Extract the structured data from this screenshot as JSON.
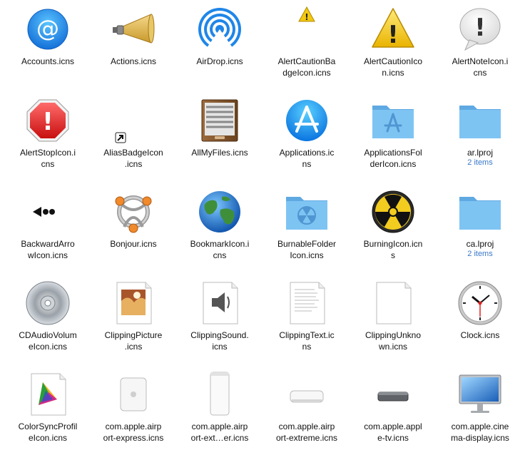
{
  "window": {
    "title": ""
  },
  "colors": {
    "label": "#111111",
    "sublabel": "#3a78c8",
    "folder": "#6cb8f0",
    "alert_yellow": "#f2c811",
    "alert_red": "#e02020"
  },
  "items": [
    {
      "label": "Accounts.icns",
      "icon": "at-sign-icon"
    },
    {
      "label": "Actions.icns",
      "icon": "megaphone-icon"
    },
    {
      "label": "AirDrop.icns",
      "icon": "airdrop-icon"
    },
    {
      "label": "AlertCautionBa\ndgeIcon.icns",
      "icon": "caution-badge-icon"
    },
    {
      "label": "AlertCautionIco\nn.icns",
      "icon": "caution-icon"
    },
    {
      "label": "AlertNoteIcon.i\ncns",
      "icon": "note-bubble-icon"
    },
    {
      "label": "AlertStopIcon.i\ncns",
      "icon": "stop-sign-icon"
    },
    {
      "label": "AliasBadgeIcon\n.icns",
      "icon": "alias-arrow-icon"
    },
    {
      "label": "AllMyFiles.icns",
      "icon": "file-drawer-icon"
    },
    {
      "label": "Applications.ic\nns",
      "icon": "app-store-icon"
    },
    {
      "label": "ApplicationsFol\nderIcon.icns",
      "icon": "applications-folder-icon"
    },
    {
      "label": "ar.lproj",
      "icon": "folder-icon",
      "sub": "2 items"
    },
    {
      "label": "BackwardArro\nwIcon.icns",
      "icon": "backward-arrow-icon"
    },
    {
      "label": "Bonjour.icns",
      "icon": "bonjour-icon"
    },
    {
      "label": "BookmarkIcon.i\ncns",
      "icon": "globe-icon"
    },
    {
      "label": "BurnableFolder\nIcon.icns",
      "icon": "burnable-folder-icon"
    },
    {
      "label": "BurningIcon.icn\ns",
      "icon": "radiation-icon"
    },
    {
      "label": "ca.lproj",
      "icon": "folder-icon",
      "sub": "2 items"
    },
    {
      "label": "CDAudioVolum\neIcon.icns",
      "icon": "cd-icon"
    },
    {
      "label": "ClippingPicture\n.icns",
      "icon": "clipping-picture-icon"
    },
    {
      "label": "ClippingSound.\nicns",
      "icon": "clipping-sound-icon"
    },
    {
      "label": "ClippingText.ic\nns",
      "icon": "clipping-text-icon"
    },
    {
      "label": "ClippingUnkno\nwn.icns",
      "icon": "clipping-unknown-icon"
    },
    {
      "label": "Clock.icns",
      "icon": "clock-icon"
    },
    {
      "label": "ColorSyncProfil\neIcon.icns",
      "icon": "colorsync-icon"
    },
    {
      "label": "com.apple.airp\nort-express.icns",
      "icon": "airport-express-icon"
    },
    {
      "label": "com.apple.airp\nort-ext…er.icns",
      "icon": "airport-extreme-tower-icon"
    },
    {
      "label": "com.apple.airp\nort-extreme.icns",
      "icon": "airport-extreme-icon"
    },
    {
      "label": "com.apple.appl\ne-tv.icns",
      "icon": "apple-tv-icon"
    },
    {
      "label": "com.apple.cine\nma-display.icns",
      "icon": "cinema-display-icon"
    }
  ]
}
